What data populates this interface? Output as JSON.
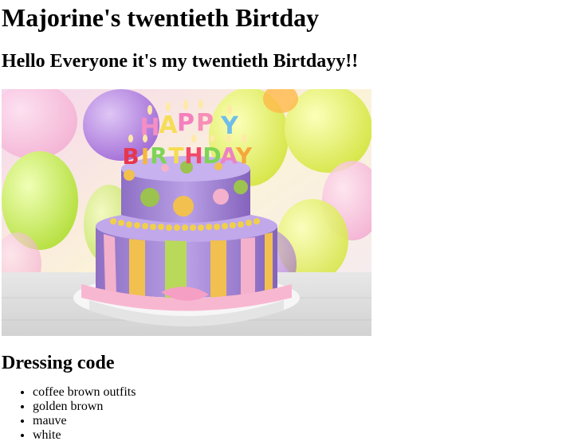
{
  "page": {
    "title": "Majorine's twentieth Birtday",
    "greeting": "Hello Everyone it's my twentieth Birtdayy!!"
  },
  "image": {
    "alt": "Birthday cake with HAPPY BIRTHDAY candles",
    "candle_top": "HAPPY",
    "candle_bottom": "BIRTHDAY"
  },
  "dress_code": {
    "heading": "Dressing code",
    "items": [
      "coffee brown outfits",
      "golden brown",
      "mauve",
      "white"
    ]
  }
}
